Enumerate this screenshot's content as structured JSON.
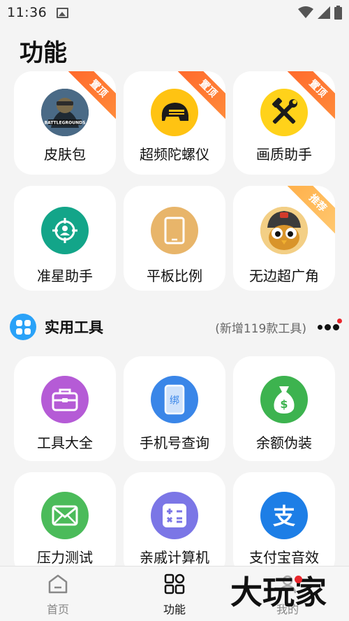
{
  "status": {
    "time": "11:36"
  },
  "page_title": "功能",
  "top_cards": [
    {
      "label": "皮肤包",
      "ribbon": "置顶",
      "icon": "battlegrounds-logo-icon",
      "color": "#2b3d4f"
    },
    {
      "label": "超频陀螺仪",
      "ribbon": "置顶",
      "icon": "helmet-icon",
      "color": "#ffc312"
    },
    {
      "label": "画质助手",
      "ribbon": "置顶",
      "icon": "tools-icon",
      "color": "#ffd21a"
    },
    {
      "label": "准星助手",
      "ribbon": "",
      "icon": "crosshair-icon",
      "color": "#13a589"
    },
    {
      "label": "平板比例",
      "ribbon": "",
      "icon": "tablet-icon",
      "color": "#e8b56a"
    },
    {
      "label": "无边超广角",
      "ribbon": "推荐",
      "icon": "owl-mascot-icon",
      "color": "#d9942a"
    }
  ],
  "section": {
    "title": "实用工具",
    "subtitle": "(新增119款工具)",
    "accent": "#2aa2f8"
  },
  "tool_cards": [
    {
      "label": "工具大全",
      "icon": "toolbox-icon",
      "color": "#b55bd6"
    },
    {
      "label": "手机号查询",
      "icon": "phone-bind-icon",
      "color": "#3a86e8",
      "icon_text": "绑"
    },
    {
      "label": "余额伪装",
      "icon": "money-bag-icon",
      "color": "#3db34f",
      "icon_text": "$"
    },
    {
      "label": "压力测试",
      "icon": "envelope-icon",
      "color": "#4bbb5a"
    },
    {
      "label": "亲戚计算机",
      "icon": "calculator-icon",
      "color": "#7b76e6"
    },
    {
      "label": "支付宝音效",
      "icon": "alipay-icon",
      "color": "#1d7ee6",
      "icon_text": "支"
    }
  ],
  "bottom_nav": [
    {
      "label": "首页",
      "icon": "home-icon"
    },
    {
      "label": "功能",
      "icon": "grid-icon",
      "active": true
    },
    {
      "label": "我的",
      "icon": "user-icon"
    }
  ],
  "watermark": "大玩家"
}
